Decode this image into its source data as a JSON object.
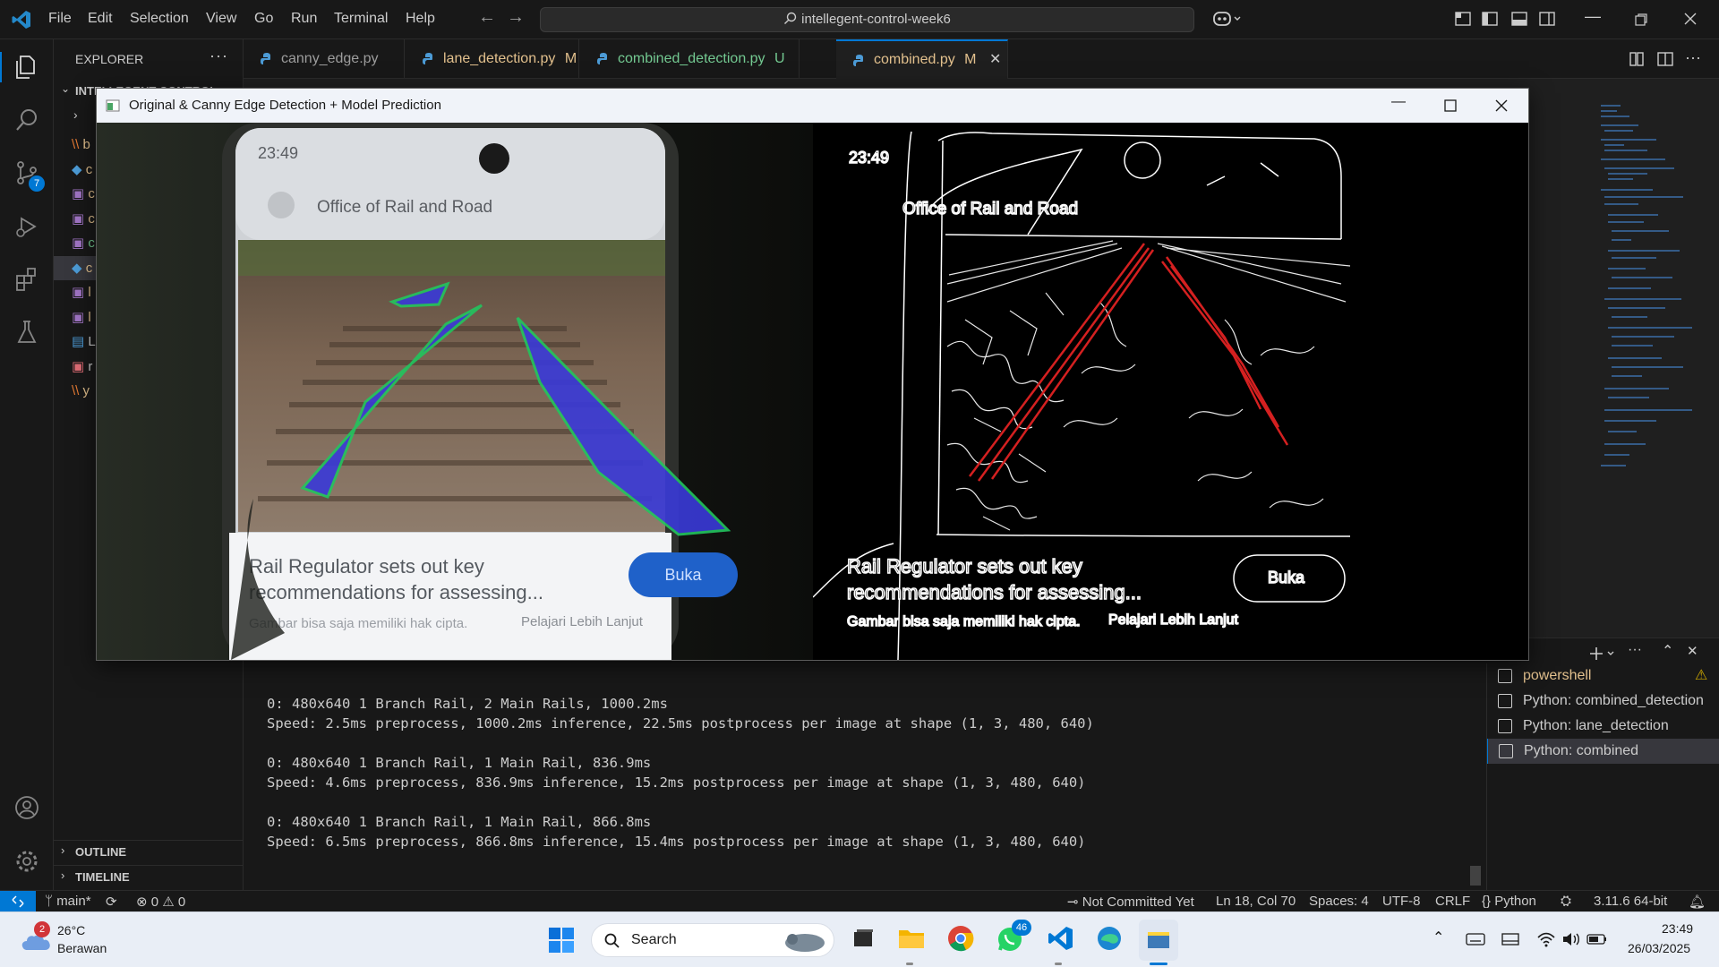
{
  "titlebar": {
    "menu": [
      "File",
      "Edit",
      "Selection",
      "View",
      "Go",
      "Run",
      "Terminal",
      "Help"
    ],
    "search_text": "intellegent-control-week6"
  },
  "sidebar": {
    "title": "EXPLORER",
    "folder": "INTELLEGENT-CONTROL-...",
    "items": [
      "b",
      "c",
      "c",
      "c",
      "c",
      "c",
      "l",
      "l",
      "L",
      "r",
      "y"
    ],
    "outline": "OUTLINE",
    "timeline": "TIMELINE"
  },
  "activity": {
    "scm_badge": "7"
  },
  "tabs": [
    {
      "name": "canny_edge.py",
      "status": ""
    },
    {
      "name": "lane_detection.py",
      "status": "M"
    },
    {
      "name": "combined_detection.py",
      "status": "U"
    },
    {
      "name": "combined.py",
      "status": "M"
    }
  ],
  "cv_window": {
    "title": "Original & Canny Edge Detection + Model Prediction",
    "phone": {
      "time": "23:49",
      "header": "Office of Rail and Road",
      "headline_1": "Rail Regulator sets out key",
      "headline_2": "recommendations for assessing...",
      "button": "Buka",
      "footer": "Gambar bisa saja memiliki hak cipta.",
      "footer_link": "Pelajari Lebih Lanjut"
    }
  },
  "terminal": {
    "lines": [
      "0: 480x640 1 Branch Rail, 2 Main Rails, 1000.2ms",
      "Speed: 2.5ms preprocess, 1000.2ms inference, 22.5ms postprocess per image at shape (1, 3, 480, 640)",
      "",
      "0: 480x640 1 Branch Rail, 1 Main Rail, 836.9ms",
      "Speed: 4.6ms preprocess, 836.9ms inference, 15.2ms postprocess per image at shape (1, 3, 480, 640)",
      "",
      "0: 480x640 1 Branch Rail, 1 Main Rail, 866.8ms",
      "Speed: 6.5ms preprocess, 866.8ms inference, 15.4ms postprocess per image at shape (1, 3, 480, 640)"
    ],
    "sessions": [
      "powershell",
      "Python: combined_detection",
      "Python: lane_detection",
      "Python: combined"
    ],
    "active_session": "Python: combined"
  },
  "statusbar": {
    "branch": "main*",
    "errors": "0",
    "warnings": "0",
    "blame": "Not Committed Yet",
    "position": "Ln 18, Col 70",
    "spaces": "Spaces: 4",
    "encoding": "UTF-8",
    "eol": "CRLF",
    "language": "Python",
    "interpreter": "3.11.6 64-bit"
  },
  "taskbar": {
    "weather_temp": "26°C",
    "weather_desc": "Berawan",
    "weather_badge": "2",
    "search": "Search",
    "whatsapp_badge": "46",
    "time": "23:49",
    "date": "26/03/2025"
  },
  "colors": {
    "accent": "#0078d4",
    "modified": "#e2c08d",
    "untracked": "#73c991",
    "prediction_fill": "#3a3ad8",
    "prediction_outline": "#22c55e",
    "edge_lane": "#d42020"
  }
}
